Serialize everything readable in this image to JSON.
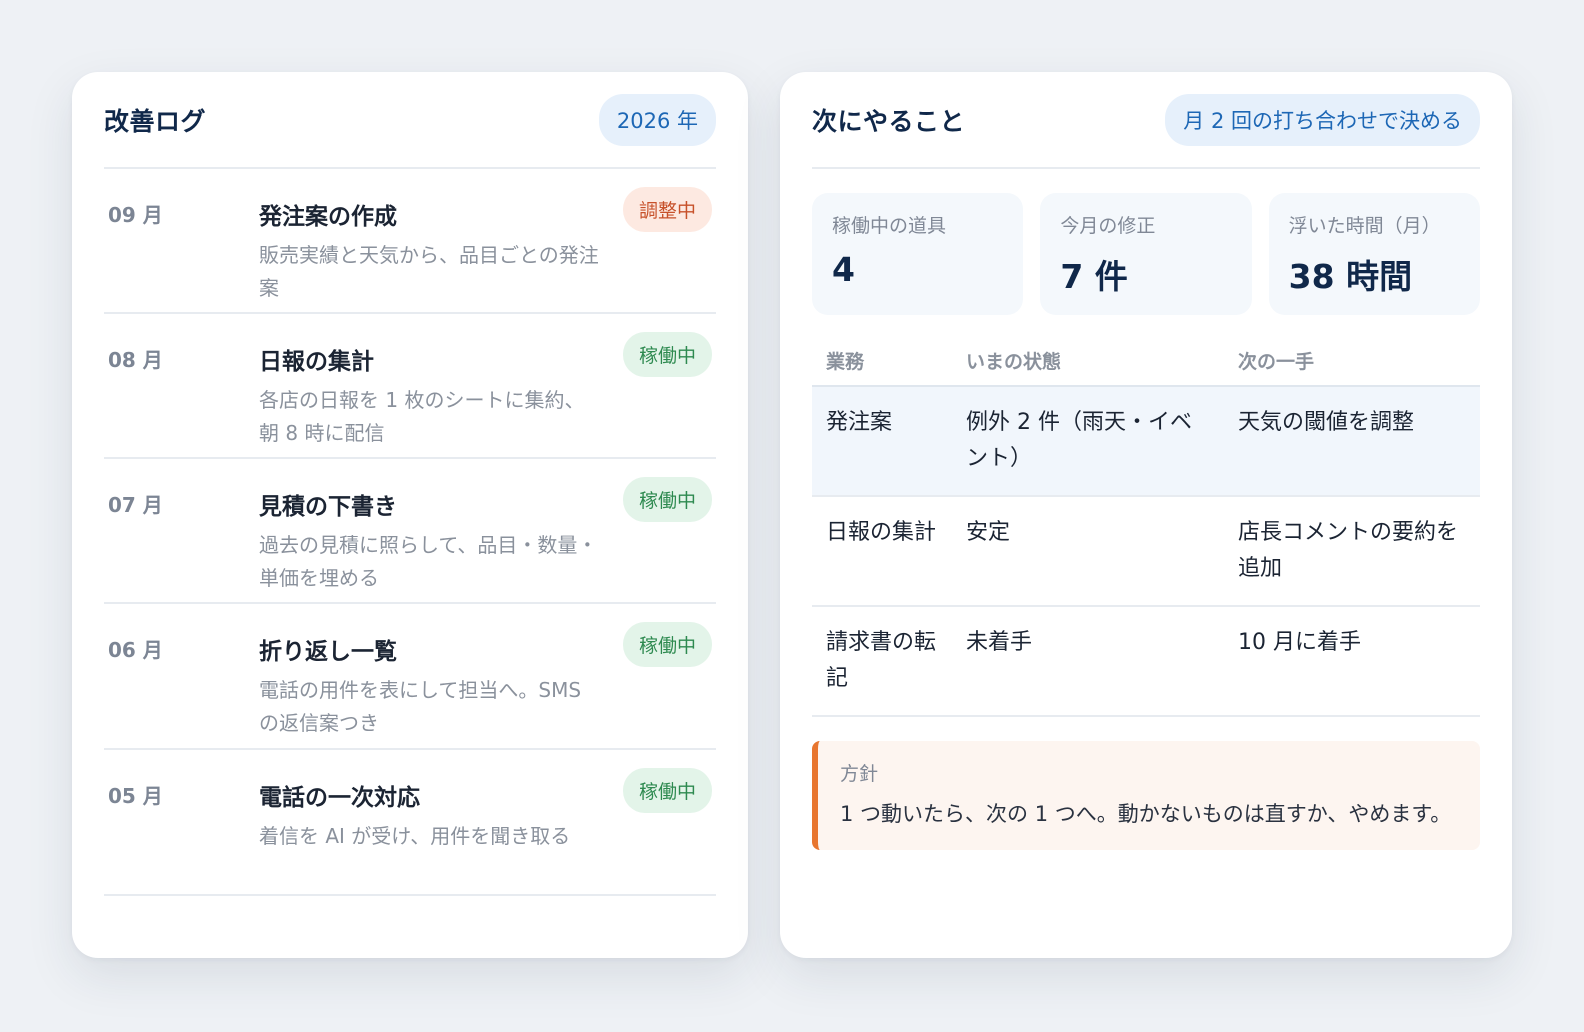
{
  "log_card": {
    "title": "改善ログ",
    "year_badge": "2026 年",
    "entries": [
      {
        "month": "09 月",
        "title": "発注案の作成",
        "desc": "販売実績と天気から、品目ごとの発注案",
        "status": "調整中",
        "status_type": "adjust"
      },
      {
        "month": "08 月",
        "title": "日報の集計",
        "desc": "各店の日報を 1 枚のシートに集約、朝 8 時に配信",
        "status": "稼働中",
        "status_type": "active"
      },
      {
        "month": "07 月",
        "title": "見積の下書き",
        "desc": "過去の見積に照らして、品目・数量・単価を埋める",
        "status": "稼働中",
        "status_type": "active"
      },
      {
        "month": "06 月",
        "title": "折り返し一覧",
        "desc": "電話の用件を表にして担当へ。SMS の返信案つき",
        "status": "稼働中",
        "status_type": "active"
      },
      {
        "month": "05 月",
        "title": "電話の一次対応",
        "desc": "着信を AI が受け、用件を聞き取る",
        "status": "稼働中",
        "status_type": "active"
      }
    ]
  },
  "next_card": {
    "title": "次にやること",
    "meeting_badge": "月 2 回の打ち合わせで決める",
    "stats": [
      {
        "label": "稼働中の道具",
        "value": "4"
      },
      {
        "label": "今月の修正",
        "value": "7 件"
      },
      {
        "label": "浮いた時間（月）",
        "value": "38 時間"
      }
    ],
    "table": {
      "headers": [
        "業務",
        "いまの状態",
        "次の一手"
      ],
      "rows": [
        [
          "発注案",
          "例外 2 件（雨天・イベント）",
          "天気の閾値を調整"
        ],
        [
          "日報の集計",
          "安定",
          "店長コメントの要約を追加"
        ],
        [
          "請求書の転記",
          "未着手",
          "10 月に着手"
        ]
      ]
    },
    "policy": {
      "label": "方針",
      "text": "1 つ動いたら、次の 1 つへ。動かないものは直すか、やめます。"
    }
  },
  "colors": {
    "accent_blue": "#1d67b5",
    "status_adjust": "#c7512a",
    "status_active": "#2e8a50",
    "policy_border": "#e8762f"
  }
}
